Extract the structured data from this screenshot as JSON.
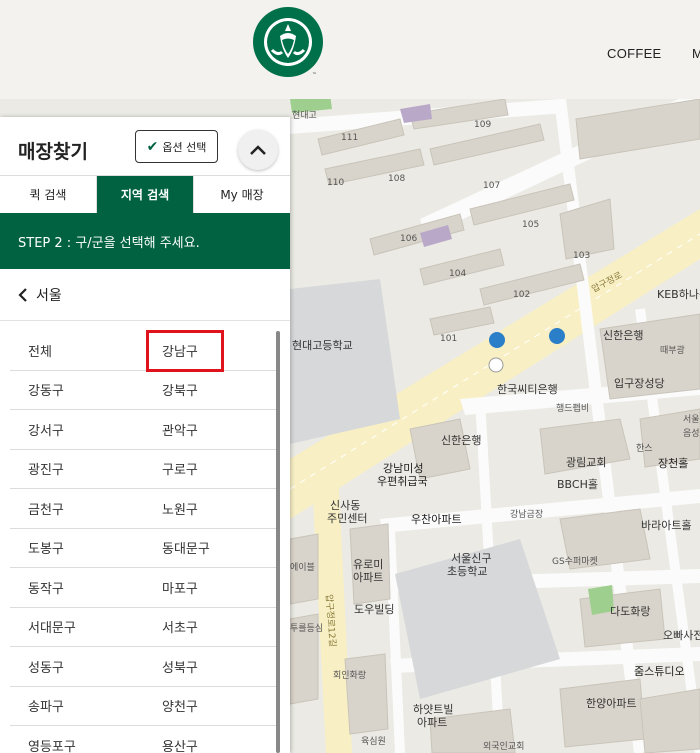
{
  "header": {
    "logo_icon": "starbucks-siren-logo",
    "nav": [
      "COFFEE",
      "M"
    ]
  },
  "panel": {
    "title": "매장찾기",
    "option_button": "옵션 선택",
    "tabs": [
      {
        "label": "퀵 검색",
        "active": false
      },
      {
        "label": "지역 검색",
        "active": true
      },
      {
        "label": "My 매장",
        "active": false
      }
    ],
    "step_text": "STEP 2 : 구/군을 선택해 주세요.",
    "back_label": "서울",
    "highlighted_district": "강남구",
    "districts": [
      [
        "전체",
        "강남구"
      ],
      [
        "강동구",
        "강북구"
      ],
      [
        "강서구",
        "관악구"
      ],
      [
        "광진구",
        "구로구"
      ],
      [
        "금천구",
        "노원구"
      ],
      [
        "도봉구",
        "동대문구"
      ],
      [
        "동작구",
        "마포구"
      ],
      [
        "서대문구",
        "서초구"
      ],
      [
        "성동구",
        "성북구"
      ],
      [
        "송파구",
        "양천구"
      ],
      [
        "영등포구",
        "용산구"
      ]
    ]
  },
  "map": {
    "labels": [
      "111",
      "109",
      "110",
      "108",
      "107",
      "106",
      "105",
      "104",
      "103",
      "102",
      "101",
      "현대고등학교",
      "한국씨티은행",
      "신한은행",
      "행드펩비",
      "입구장성당",
      "KEB하나은",
      "때부광",
      "서울",
      "광림교회",
      "한스",
      "장천홀",
      "BBCH홀",
      "바라아트홀",
      "강남미성",
      "우편취급국",
      "신사동",
      "주민센터",
      "우찬아파트",
      "강남금장",
      "서울신구",
      "초등학교",
      "GS수퍼마켓",
      "다도화랑",
      "오빠사전",
      "유로미",
      "아파트",
      "도우빌딩",
      "회인화랑",
      "줌스튜디오",
      "한양아파트",
      "하얏트빌",
      "아파트",
      "외국인교회",
      "육심원",
      "압구정로",
      "압구정로12길",
      "음성을",
      "에이블",
      "투를등심",
      "현대고",
      "신한은행"
    ],
    "colors": {
      "brand_green": "#006241",
      "highlight_red": "#e0121b",
      "road_yellow": "#f7efc0"
    }
  }
}
